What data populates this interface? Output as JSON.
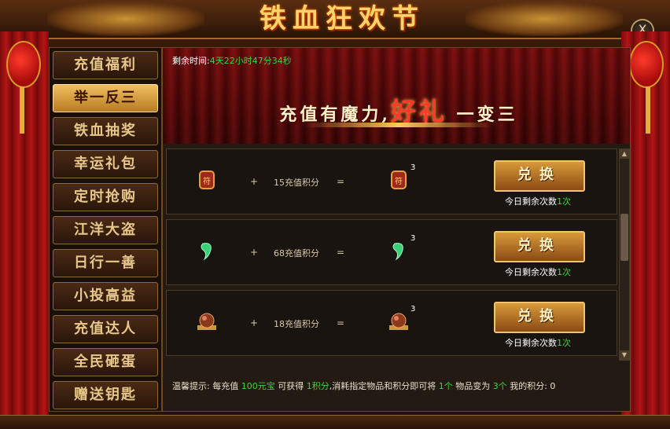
{
  "header": {
    "title": "铁血狂欢节",
    "close_label": "X"
  },
  "menu": [
    {
      "label": "充值福利",
      "active": false
    },
    {
      "label": "举一反三",
      "active": true
    },
    {
      "label": "铁血抽奖",
      "active": false
    },
    {
      "label": "幸运礼包",
      "active": false
    },
    {
      "label": "定时抢购",
      "active": false
    },
    {
      "label": "江洋大盗",
      "active": false
    },
    {
      "label": "日行一善",
      "active": false
    },
    {
      "label": "小投高益",
      "active": false
    },
    {
      "label": "充值达人",
      "active": false
    },
    {
      "label": "全民砸蛋",
      "active": false
    },
    {
      "label": "赠送钥匙",
      "active": false
    }
  ],
  "banner": {
    "timer_label": "剩余时间:",
    "timer_value": "4天22小时47分34秒",
    "slogan_a": "充值有魔力,",
    "slogan_b": "好礼",
    "slogan_c": "一变三"
  },
  "rows": [
    {
      "icon": "red-pouch-icon",
      "plus": "+",
      "cost": "15充值积分",
      "eq": "=",
      "qty": "3",
      "button": "兑换",
      "remain_label": "今日剩余次数",
      "remain_count": "1次"
    },
    {
      "icon": "jade-icon",
      "plus": "+",
      "cost": "68充值积分",
      "eq": "=",
      "qty": "3",
      "button": "兑换",
      "remain_label": "今日剩余次数",
      "remain_count": "1次"
    },
    {
      "icon": "bead-icon",
      "plus": "+",
      "cost": "18充值积分",
      "eq": "=",
      "qty": "3",
      "button": "兑换",
      "remain_label": "今日剩余次数",
      "remain_count": "1次"
    }
  ],
  "footer": {
    "t1": "温馨提示: 每充值 ",
    "g1": "100元宝",
    "t2": " 可获得 ",
    "g2": "1积分",
    "t3": ",消耗指定物品和积分即可将 ",
    "g3": "1个",
    "t4": " 物品变为 ",
    "g4": "3个",
    "t5": "  我的积分: ",
    "score": "0"
  },
  "colors": {
    "accent_green": "#37d637",
    "gold": "#ffd36a",
    "red": "#b51515"
  }
}
